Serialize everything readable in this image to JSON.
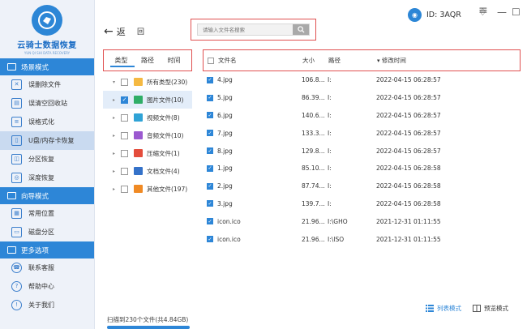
{
  "app": {
    "title": "云骑士数据恢复",
    "subtitle": "YUN QI SHI DATA RECOVERY",
    "user_id": "ID: 3AQR",
    "minimize": "—",
    "maximize": "☐",
    "close": "✕"
  },
  "sidebar": {
    "sections": [
      {
        "title": "场景模式",
        "items": [
          {
            "label": "误删除文件",
            "icon": "delete-file-icon"
          },
          {
            "label": "误清空回收站",
            "icon": "recycle-bin-icon"
          },
          {
            "label": "误格式化",
            "icon": "format-icon"
          },
          {
            "label": "U盘/内存卡恢复",
            "icon": "usb-icon",
            "active": true
          },
          {
            "label": "分区恢复",
            "icon": "partition-icon"
          },
          {
            "label": "深度恢复",
            "icon": "deep-scan-icon"
          }
        ]
      },
      {
        "title": "向导模式",
        "items": [
          {
            "label": "常用位置",
            "icon": "location-icon"
          },
          {
            "label": "磁盘分区",
            "icon": "disk-icon"
          }
        ]
      },
      {
        "title": "更多选项",
        "items": [
          {
            "label": "联系客服",
            "icon": "support-icon"
          },
          {
            "label": "帮助中心",
            "icon": "help-icon"
          },
          {
            "label": "关于我们",
            "icon": "info-icon"
          }
        ]
      }
    ]
  },
  "toolbar": {
    "back_label": "返",
    "home_label": "回",
    "search_placeholder": "请输入文件名搜索"
  },
  "category_panel": {
    "tabs": [
      "类型",
      "路径",
      "时间"
    ],
    "items": [
      {
        "label": "所有类型(230)",
        "color": "#f5b942",
        "checked": false,
        "expand": "▾"
      },
      {
        "label": "图片文件(10)",
        "color": "#2fae67",
        "checked": true,
        "expand": "▸",
        "selected": true
      },
      {
        "label": "视频文件(8)",
        "color": "#2fa3d6",
        "checked": false,
        "expand": "▸"
      },
      {
        "label": "音频文件(10)",
        "color": "#9b59d0",
        "checked": false,
        "expand": "▸"
      },
      {
        "label": "压缩文件(1)",
        "color": "#e44d3c",
        "checked": false,
        "expand": "▸"
      },
      {
        "label": "文档文件(4)",
        "color": "#3572c9",
        "checked": false,
        "expand": "▸"
      },
      {
        "label": "其他文件(197)",
        "color": "#f08a24",
        "checked": false,
        "expand": "▸"
      }
    ]
  },
  "file_table": {
    "columns": {
      "name": "文件名",
      "size": "大小",
      "path": "路径",
      "date": "修改时间"
    },
    "sort_indicator": "▾",
    "rows": [
      {
        "name": "4.jpg",
        "size": "106.8...",
        "path": "I:",
        "date": "2022-04-15 06:28:57"
      },
      {
        "name": "5.jpg",
        "size": "86.39...",
        "path": "I:",
        "date": "2022-04-15 06:28:57"
      },
      {
        "name": "6.jpg",
        "size": "140.6...",
        "path": "I:",
        "date": "2022-04-15 06:28:57"
      },
      {
        "name": "7.jpg",
        "size": "133.3...",
        "path": "I:",
        "date": "2022-04-15 06:28:57"
      },
      {
        "name": "8.jpg",
        "size": "129.8...",
        "path": "I:",
        "date": "2022-04-15 06:28:57"
      },
      {
        "name": "1.jpg",
        "size": "85.10...",
        "path": "I:",
        "date": "2022-04-15 06:28:58"
      },
      {
        "name": "2.jpg",
        "size": "87.74...",
        "path": "I:",
        "date": "2022-04-15 06:28:58"
      },
      {
        "name": "3.jpg",
        "size": "139.7...",
        "path": "I:",
        "date": "2022-04-15 06:28:58"
      },
      {
        "name": "icon.ico",
        "size": "21.96...",
        "path": "I:\\GHO",
        "date": "2021-12-31 01:11:55"
      },
      {
        "name": "icon.ico",
        "size": "21.96...",
        "path": "I:\\ISO",
        "date": "2021-12-31 01:11:55"
      }
    ]
  },
  "status": {
    "scan_summary": "扫描到230个文件(共4.84GB)"
  },
  "view_modes": {
    "list": "列表模式",
    "preview": "预览模式"
  },
  "colors": {
    "accent": "#2d86d7",
    "highlight": "#e05050"
  }
}
